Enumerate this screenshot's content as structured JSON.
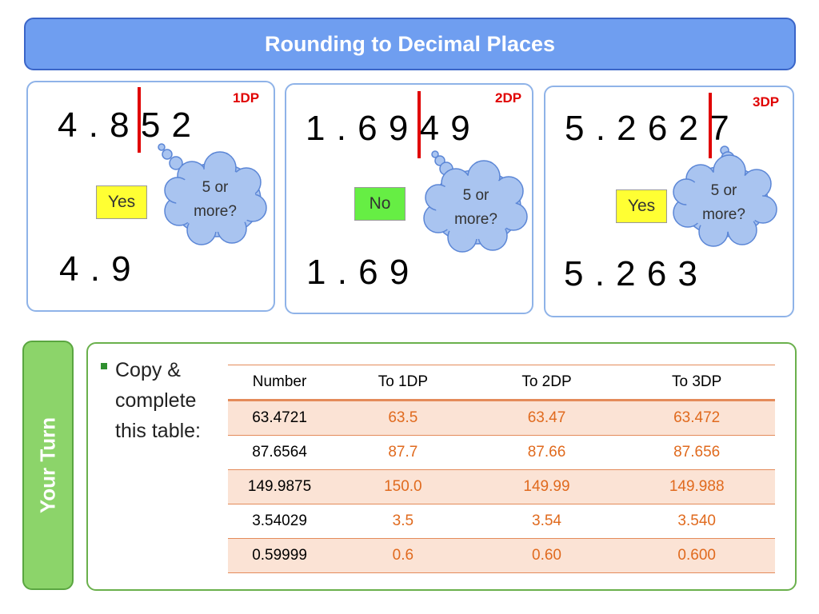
{
  "title": "Rounding to Decimal Places",
  "examples": [
    {
      "dp": "1DP",
      "number": "4 . 8 5 2",
      "answer": "Yes",
      "result": "4 . 9",
      "cloud_line1": "5 or",
      "cloud_line2": "more?"
    },
    {
      "dp": "2DP",
      "number": "1 . 6 9 4 9",
      "answer": "No",
      "result": "1 . 6 9",
      "cloud_line1": "5 or",
      "cloud_line2": "more?"
    },
    {
      "dp": "3DP",
      "number": "5 . 2 6 2 7",
      "answer": "Yes",
      "result": "5 . 2 6 3",
      "cloud_line1": "5 or",
      "cloud_line2": "more?"
    }
  ],
  "your_turn": {
    "tab_label": "Your Turn",
    "instruction": "Copy & complete this table:",
    "table": {
      "headers": [
        "Number",
        "To 1DP",
        "To 2DP",
        "To 3DP"
      ],
      "rows": [
        [
          "63.4721",
          "63.5",
          "63.47",
          "63.472"
        ],
        [
          "87.6564",
          "87.7",
          "87.66",
          "87.656"
        ],
        [
          "149.9875",
          "150.0",
          "149.99",
          "149.988"
        ],
        [
          "3.54029",
          "3.5",
          "3.54",
          "3.540"
        ],
        [
          "0.59999",
          "0.6",
          "0.60",
          "0.600"
        ]
      ]
    }
  },
  "colors": {
    "title_bg": "#6f9ef0",
    "highlight_red": "#e00000",
    "yes_box": "#ffff33",
    "no_box": "#66ee44",
    "cloud_fill": "#a9c4f0",
    "tab_green": "#8cd46a",
    "answer_orange": "#e06a1e",
    "row_shade": "#fbe3d5"
  }
}
